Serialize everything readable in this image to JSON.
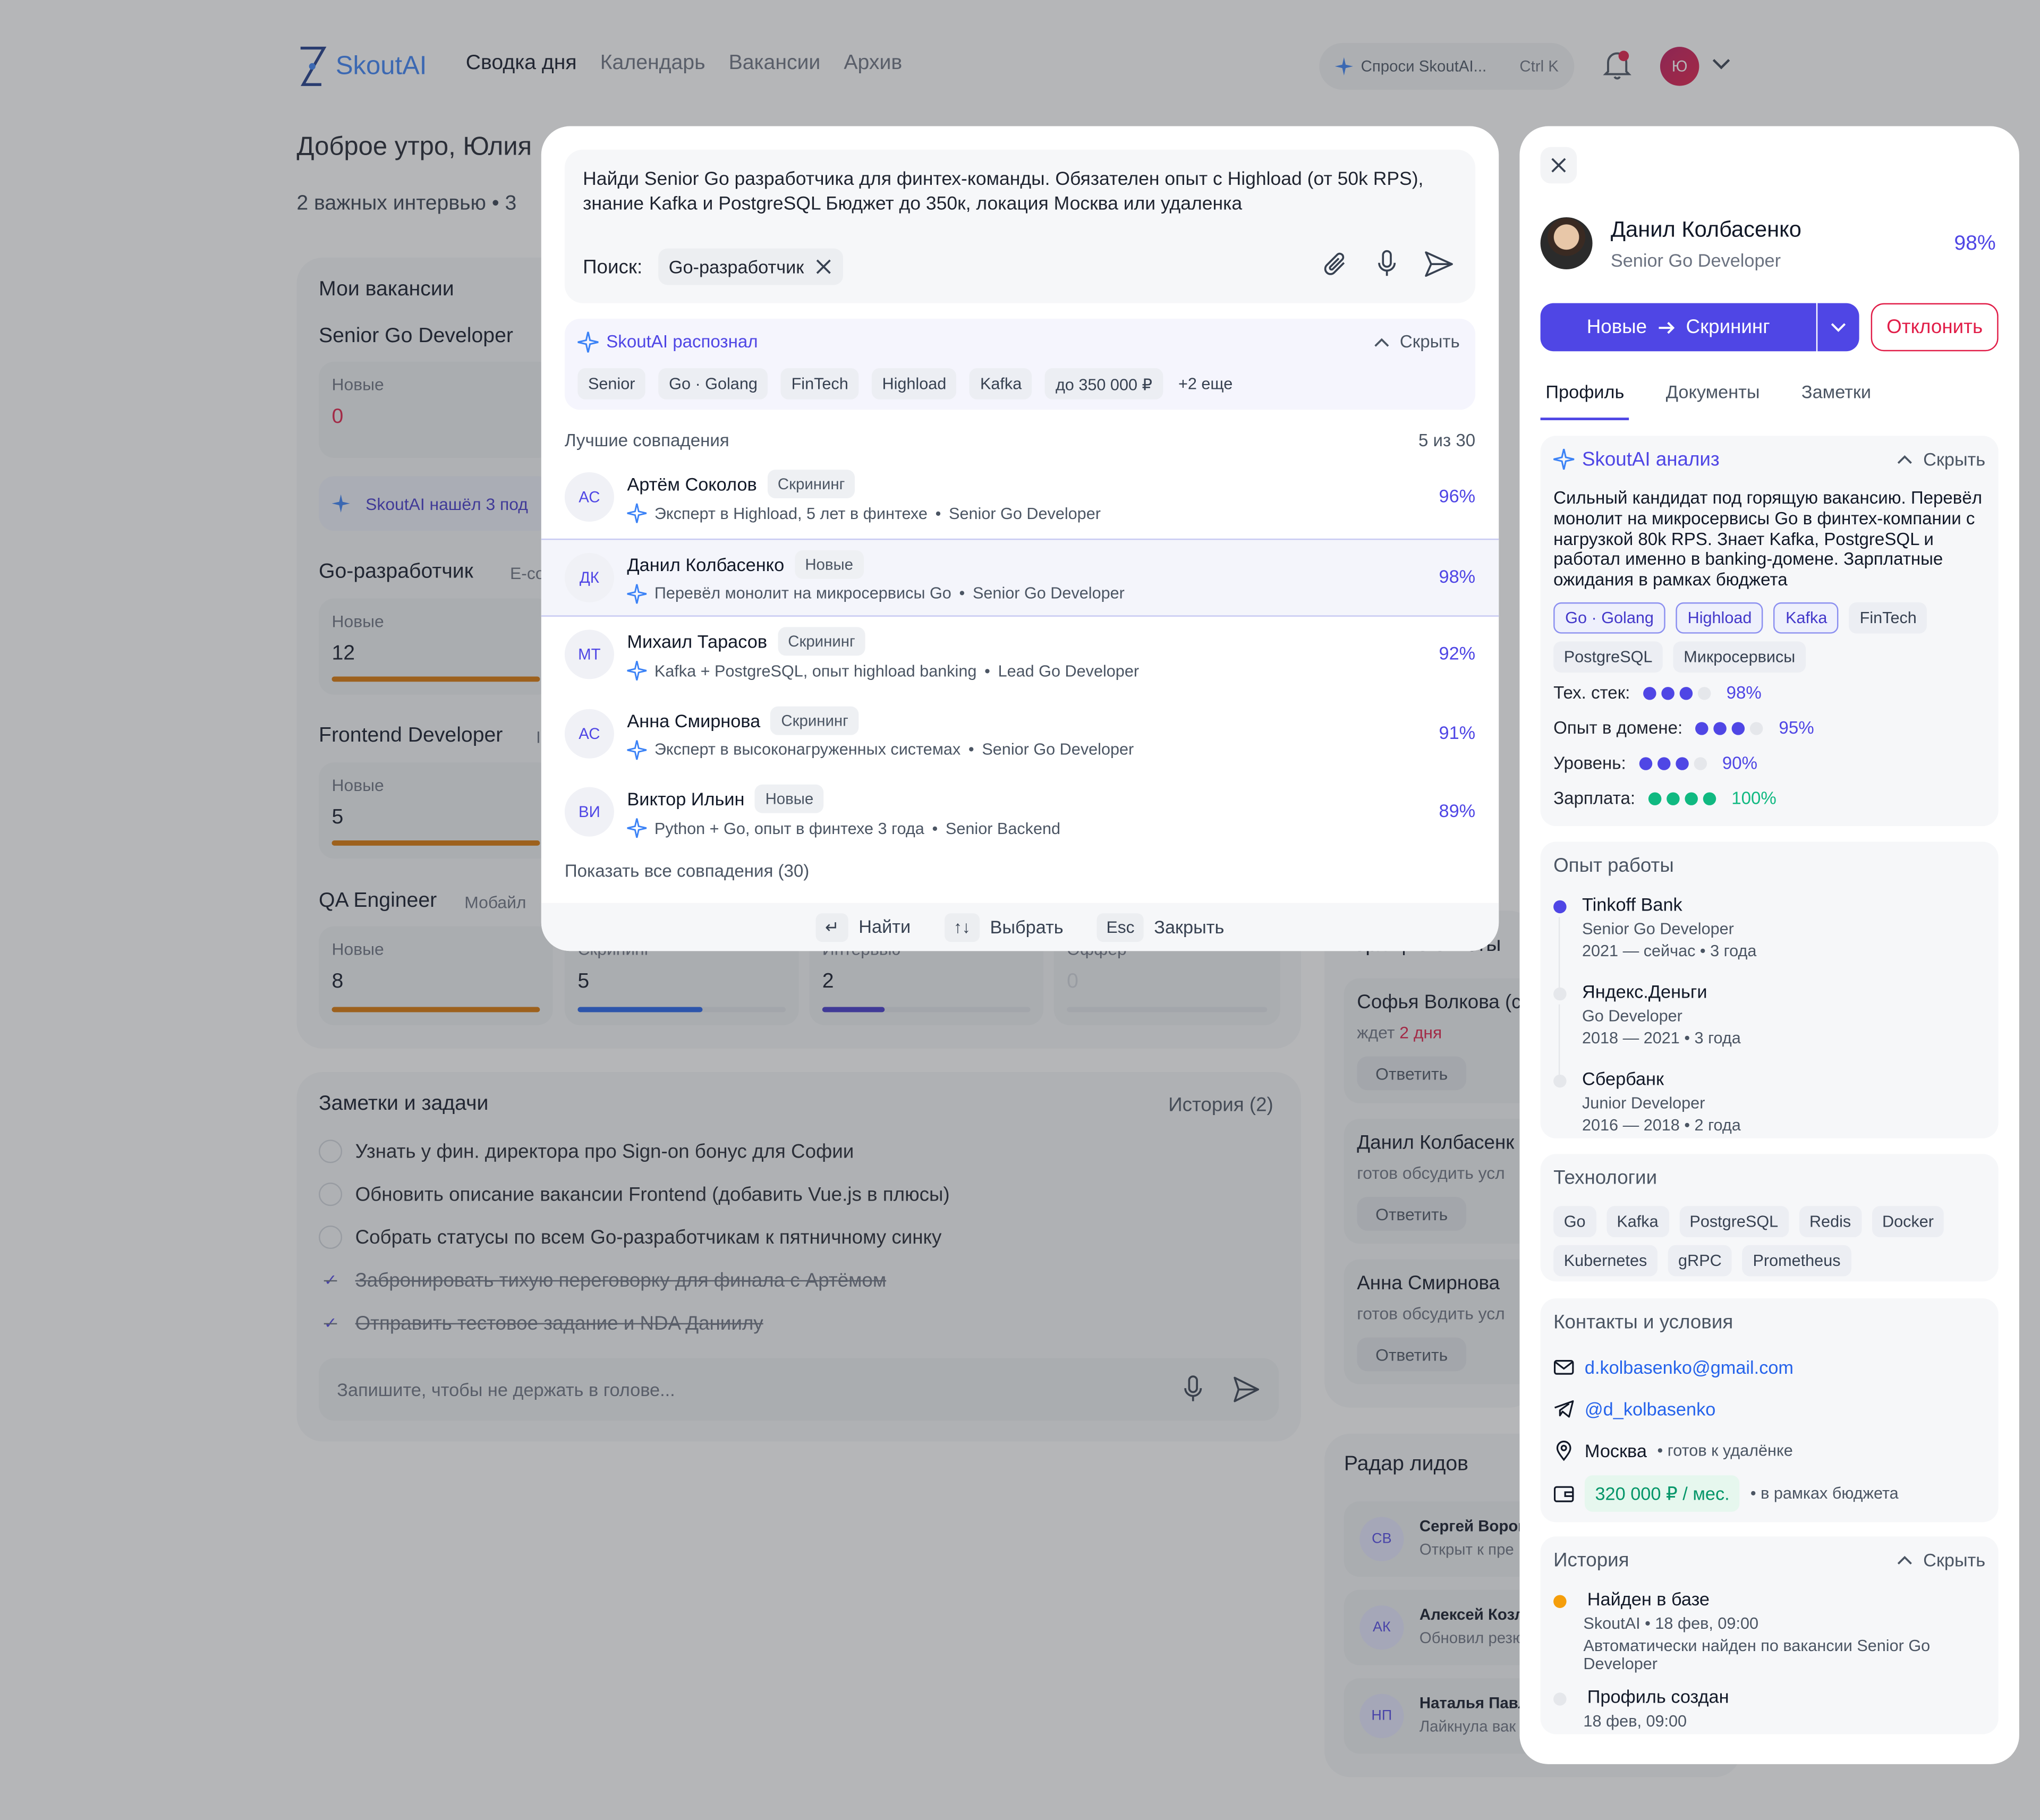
{
  "app": {
    "brand": "SkoutAI"
  },
  "nav": {
    "items": [
      "Сводка дня",
      "Календарь",
      "Вакансии",
      "Архив"
    ]
  },
  "ask": {
    "label": "Спроси SkoutAI...",
    "shortcut": "Ctrl K"
  },
  "user": {
    "initials": "Ю"
  },
  "greeting": {
    "title": "Доброе утро, Юлия",
    "summary": "2 важных интервью  •  3"
  },
  "vacancies": {
    "title": "Мои вакансии",
    "items": [
      {
        "name": "Senior Go Developer",
        "stage_label": "Новые",
        "stage_value": "0"
      },
      {
        "name": "Go-разработчик",
        "tag": "E-co",
        "stage_label": "Новые",
        "stage_value": "12"
      },
      {
        "name": "Frontend Developer",
        "tag": "I",
        "stage_label": "Новые",
        "stage_value": "5"
      },
      {
        "name": "QA Engineer",
        "tag": "Мобайл",
        "stage_label": "Новые",
        "stage_value": "8"
      }
    ],
    "found_strip": "SkoutAI нашёл 3 под",
    "qa_tiles": [
      {
        "label": "Скрининг",
        "value": "5",
        "progress": 0.6
      },
      {
        "label": "Интервью",
        "value": "2",
        "progress": 0.3
      },
      {
        "label": "Оффер",
        "value": "0",
        "progress": 0
      }
    ]
  },
  "notes": {
    "title": "Заметки и задачи",
    "history": "История (2)",
    "tasks": [
      {
        "text": "Узнать у фин. директора про Sign-on бонус для Софии",
        "done": false
      },
      {
        "text": "Обновить описание вакансии Frontend (добавить Vue.js в плюсы)",
        "done": false
      },
      {
        "text": "Собрать статусы по всем Go-разработчикам к пятничному синку",
        "done": false
      },
      {
        "text": "Забронировать тихую переговорку для финала с Артёмом",
        "done": true
      },
      {
        "text": "Отправить тестовое задание и NDA Даниилу",
        "done": true
      }
    ],
    "placeholder": "Запишите, чтобы не держать в голове..."
  },
  "responses": {
    "title": "Горящие ответы",
    "items": [
      {
        "name": "Софья Волкова (с",
        "status_prefix": "ждет ",
        "status_hl": "2 дня",
        "button": "Ответить"
      },
      {
        "name": "Данил Колбасенк",
        "status_prefix": "готов обсудить усл",
        "status_hl": "",
        "button": "Ответить"
      },
      {
        "name": "Анна Смирнова",
        "status_prefix": "готов обсудить усл",
        "status_hl": "",
        "button": "Ответить"
      }
    ]
  },
  "leads": {
    "title": "Радар лидов",
    "items": [
      {
        "initials": "СВ",
        "name": "Сергей Ворон",
        "status": "Открыт к пре"
      },
      {
        "initials": "АК",
        "name": "Алексей Козл",
        "status": "Обновил резю"
      },
      {
        "initials": "НП",
        "name": "Наталья Павл",
        "status": "Лайкнула вак"
      }
    ]
  },
  "search_modal": {
    "query": "Найди Senior Go разработчика для финтех-команды. Обязателен опыт с Highload (от 50k RPS), знание Kafka и PostgreSQL Бюджет до 350к, локация Москва или удаленка",
    "search_label": "Поиск:",
    "search_chip": "Go-разработчик",
    "recognized_title": "SkoutAI распознал",
    "hide_label": "Скрыть",
    "recognized_tags": [
      "Senior",
      "Go · Golang",
      "FinTech",
      "Highload",
      "Kafka",
      "до 350 000 ₽",
      "+2 еще"
    ],
    "best_title": "Лучшие совпадения",
    "best_count": "5 из 30",
    "matches": [
      {
        "initials": "АС",
        "name": "Артём Соколов",
        "stage": "Скрининг",
        "desc": "Эксперт в Highload, 5 лет в финтехе",
        "role": "Senior Go Developer",
        "pct": "96%",
        "selected": false
      },
      {
        "initials": "ДК",
        "name": "Данил Колбасенко",
        "stage": "Новые",
        "desc": "Перевёл монолит на микросервисы Go",
        "role": "Senior Go Developer",
        "pct": "98%",
        "selected": true
      },
      {
        "initials": "МТ",
        "name": "Михаил Тарасов",
        "stage": "Скрининг",
        "desc": "Kafka + PostgreSQL, опыт highload banking",
        "role": "Lead Go Developer",
        "pct": "92%",
        "selected": false
      },
      {
        "initials": "АС",
        "name": "Анна Смирнова",
        "stage": "Скрининг",
        "desc": "Эксперт в высоконагруженных системах",
        "role": "Senior Go Developer",
        "pct": "91%",
        "selected": false
      },
      {
        "initials": "ВИ",
        "name": "Виктор Ильин",
        "stage": "Новые",
        "desc": "Python + Go, опыт в финтехе 3 года",
        "role": "Senior Backend",
        "pct": "89%",
        "selected": false
      }
    ],
    "show_all": "Показать все совпадения (30)",
    "footer": [
      {
        "key": "↵",
        "label": "Найти"
      },
      {
        "key": "↑↓",
        "label": "Выбрать"
      },
      {
        "key": "Esc",
        "label": "Закрыть"
      }
    ]
  },
  "candidate": {
    "name": "Данил Колбасенко",
    "role": "Senior Go Developer",
    "match_pct": "98%",
    "stage_from": "Новые",
    "stage_to": "Скрининг",
    "reject": "Отклонить",
    "tabs": [
      "Профиль",
      "Документы",
      "Заметки"
    ],
    "ai": {
      "title": "SkoutAI анализ",
      "hide": "Скрыть",
      "text": "Сильный кандидат под горящую вакансию. Перевёл монолит на микросервисы Go в финтех-компании с нагрузкой 80k RPS. Знает Kafka, PostgreSQL и работал именно в banking-домене. Зарплатные ожидания в рамках бюджета",
      "tags_row1": [
        {
          "text": "Go · Golang",
          "hl": true
        },
        {
          "text": "Highload",
          "hl": true
        },
        {
          "text": "Kafka",
          "hl": true
        },
        {
          "text": "FinTech",
          "hl": false
        }
      ],
      "tags_row2": [
        {
          "text": "PostgreSQL",
          "hl": false
        },
        {
          "text": "Микросервисы",
          "hl": false
        }
      ],
      "scores": [
        {
          "label": "Тех. стек:",
          "value": "98%",
          "filled": 3,
          "total": 4,
          "color": "#4f46e5"
        },
        {
          "label": "Опыт в домене:",
          "value": "95%",
          "filled": 3,
          "total": 4,
          "color": "#4f46e5"
        },
        {
          "label": "Уровень:",
          "value": "90%",
          "filled": 3,
          "total": 4,
          "color": "#4f46e5"
        },
        {
          "label": "Зарплата:",
          "value": "100%",
          "filled": 4,
          "total": 4,
          "color": "#10b981"
        }
      ]
    },
    "experience": {
      "title": "Опыт работы",
      "items": [
        {
          "company": "Tinkoff Bank",
          "role": "Senior Go Developer",
          "dates": "2021 — сейчас  •  3 года",
          "current": true
        },
        {
          "company": "Яндекс.Деньги",
          "role": "Go Developer",
          "dates": "2018 — 2021  •  3 года",
          "current": false
        },
        {
          "company": "Сбербанк",
          "role": "Junior Developer",
          "dates": "2016 — 2018  •  2 года",
          "current": false
        }
      ]
    },
    "tech": {
      "title": "Технологии",
      "row1": [
        "Go",
        "Kafka",
        "PostgreSQL",
        "Redis",
        "Docker"
      ],
      "row2": [
        "Kubernetes",
        "gRPC",
        "Prometheus"
      ]
    },
    "contacts": {
      "title": "Контакты и условия",
      "email": "d.kolbasenko@gmail.com",
      "telegram": "@d_kolbasenko",
      "city": "Москва",
      "relocation": "готов к удалёнке",
      "salary": "320 000 ₽ / мес.",
      "salary_note": "в рамках бюджета"
    },
    "history": {
      "title": "История",
      "hide": "Скрыть",
      "items": [
        {
          "title": "Найден в базе",
          "meta": "SkoutAI  •  18 фев, 09:00",
          "desc": "Автоматически найден по вакансии Senior Go Developer",
          "color": "#f59e0b"
        },
        {
          "title": "Профиль создан",
          "meta": "18 фев, 09:00",
          "desc": "",
          "color": "#e5e7eb"
        }
      ]
    }
  },
  "colors": {
    "accent": "#4f46e5",
    "danger": "#e11d48",
    "success": "#10b981",
    "bar_orange": "#d97706",
    "bar_blue": "#2563eb"
  }
}
